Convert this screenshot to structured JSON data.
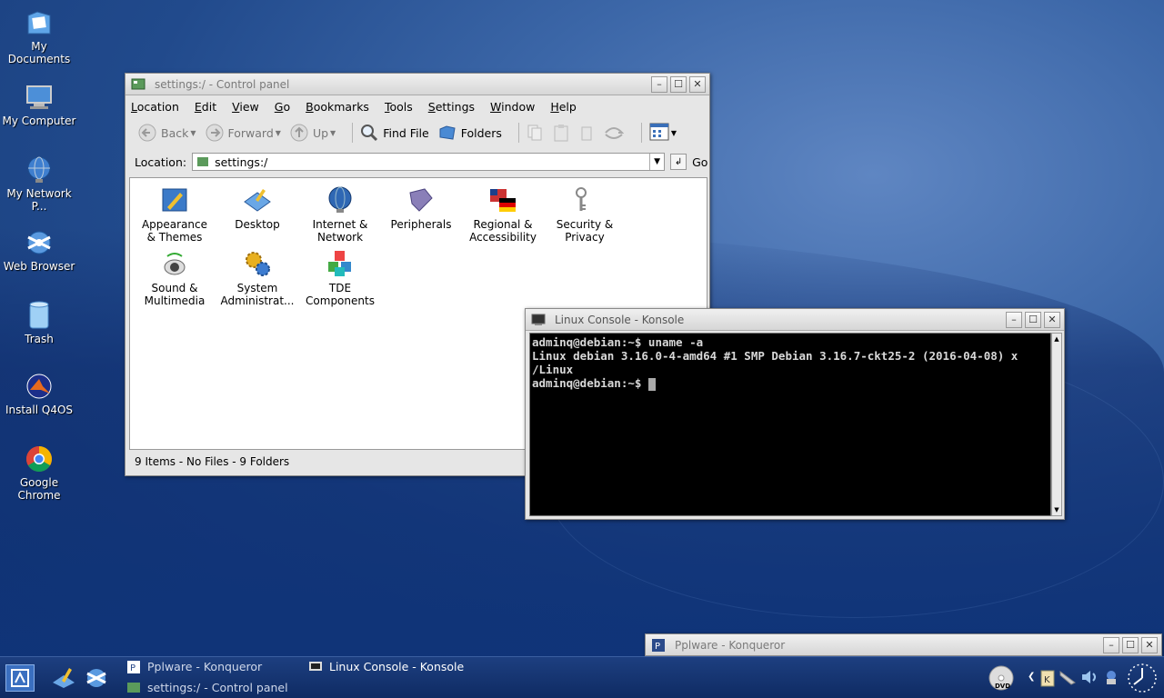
{
  "desktop": {
    "icons": [
      {
        "label": "My Documents"
      },
      {
        "label": "My Computer"
      },
      {
        "label": "My Network P..."
      },
      {
        "label": "Web Browser"
      },
      {
        "label": "Trash"
      },
      {
        "label": "Install Q4OS"
      },
      {
        "label": "Google Chrome"
      }
    ]
  },
  "control_panel": {
    "title": "settings:/ - Control panel",
    "menu": [
      "Location",
      "Edit",
      "View",
      "Go",
      "Bookmarks",
      "Tools",
      "Settings",
      "Window",
      "Help"
    ],
    "toolbar": {
      "back": "Back",
      "forward": "Forward",
      "up": "Up",
      "find": "Find File",
      "folders": "Folders"
    },
    "location_label": "Location:",
    "location_value": "settings:/",
    "go_label": "Go",
    "items": [
      {
        "line1": "Appearance",
        "line2": "& Themes"
      },
      {
        "line1": "Desktop",
        "line2": ""
      },
      {
        "line1": "Internet &",
        "line2": "Network"
      },
      {
        "line1": "Peripherals",
        "line2": ""
      },
      {
        "line1": "Regional &",
        "line2": "Accessibility"
      },
      {
        "line1": "Security &",
        "line2": "Privacy"
      },
      {
        "line1": "Sound &",
        "line2": "Multimedia"
      },
      {
        "line1": "System",
        "line2": "Administrat..."
      },
      {
        "line1": "TDE",
        "line2": "Components"
      }
    ],
    "status": "9 Items - No Files - 9 Folders"
  },
  "konsole": {
    "title": "Linux Console - Konsole",
    "lines": [
      "adminq@debian:~$ uname -a",
      "Linux debian 3.16.0-4-amd64 #1 SMP Debian 3.16.7-ckt25-2 (2016-04-08) x",
      "/Linux",
      "adminq@debian:~$ "
    ]
  },
  "konqueror_min": {
    "title": "Pplware - Konqueror"
  },
  "taskbar": {
    "tasks": [
      {
        "label": "Pplware - Konqueror"
      },
      {
        "label": "settings:/ - Control panel"
      },
      {
        "label": "Linux Console - Konsole"
      }
    ]
  },
  "colors": {
    "taskbar": "#153575",
    "terminal_bg": "#000000",
    "desktop": "#214a8c"
  }
}
